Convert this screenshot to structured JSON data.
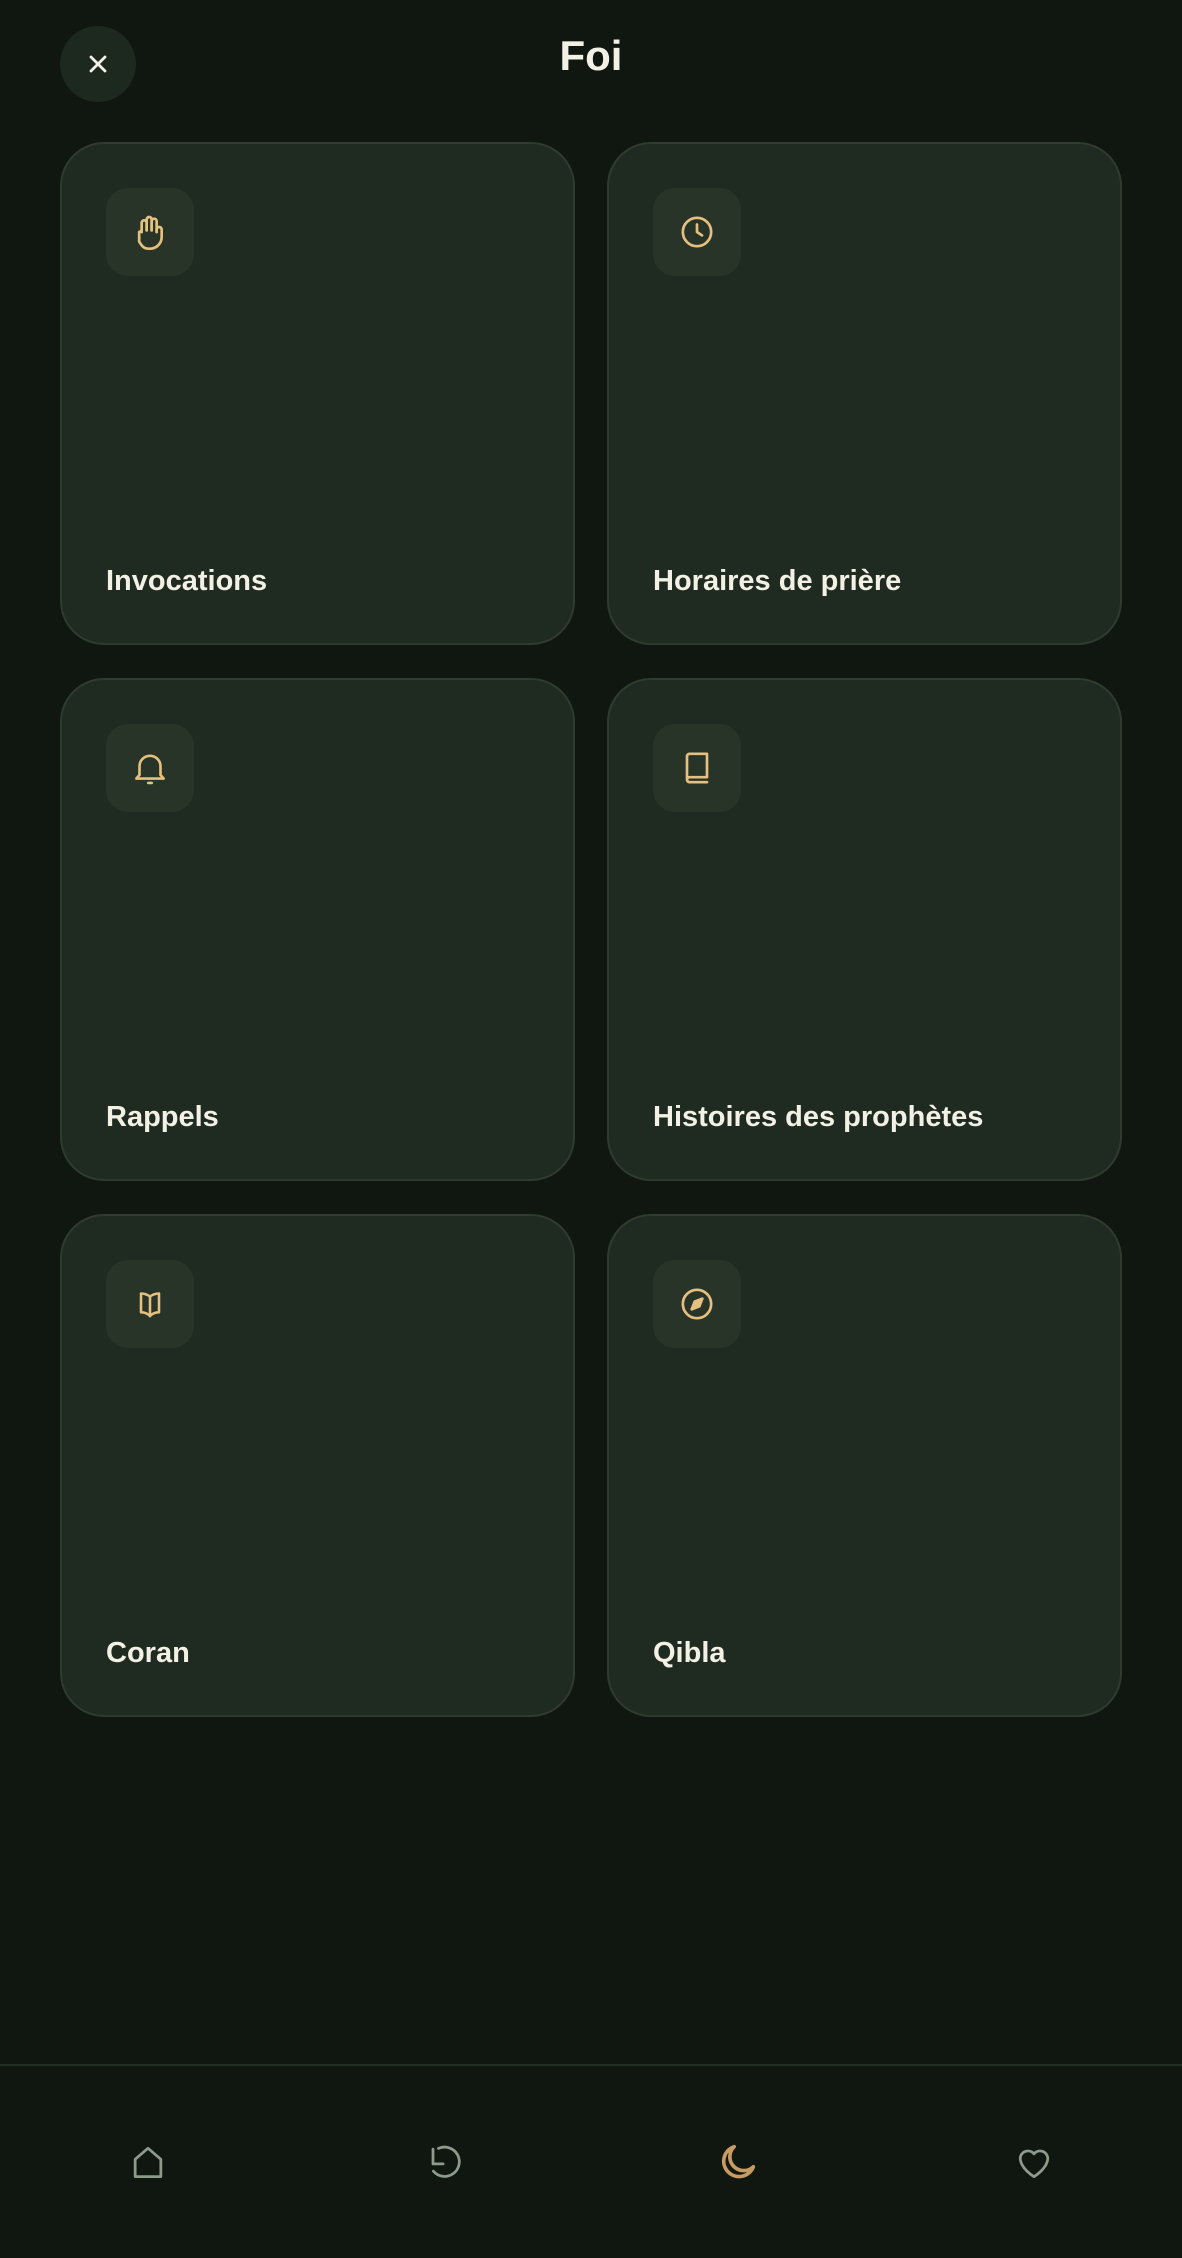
{
  "header": {
    "title": "Foi",
    "close_icon": "close-icon"
  },
  "cards": [
    {
      "label": "Invocations",
      "icon": "hand-icon"
    },
    {
      "label": "Horaires de prière",
      "icon": "clock-icon"
    },
    {
      "label": "Rappels",
      "icon": "bell-icon"
    },
    {
      "label": "Histoires des prophètes",
      "icon": "book-icon"
    },
    {
      "label": "Coran",
      "icon": "open-book-icon"
    },
    {
      "label": "Qibla",
      "icon": "compass-icon"
    }
  ],
  "bottom_nav": {
    "items": [
      {
        "icon": "home-icon",
        "active": false
      },
      {
        "icon": "history-icon",
        "active": false
      },
      {
        "icon": "moon-icon",
        "active": true
      },
      {
        "icon": "heart-icon",
        "active": false
      }
    ]
  },
  "colors": {
    "background": "#0f1710",
    "card": "#1f2b20",
    "accent": "#e6c07e",
    "nav_inactive": "#8e9a8c",
    "nav_active": "#c99a62",
    "text": "#f3f1e6"
  }
}
